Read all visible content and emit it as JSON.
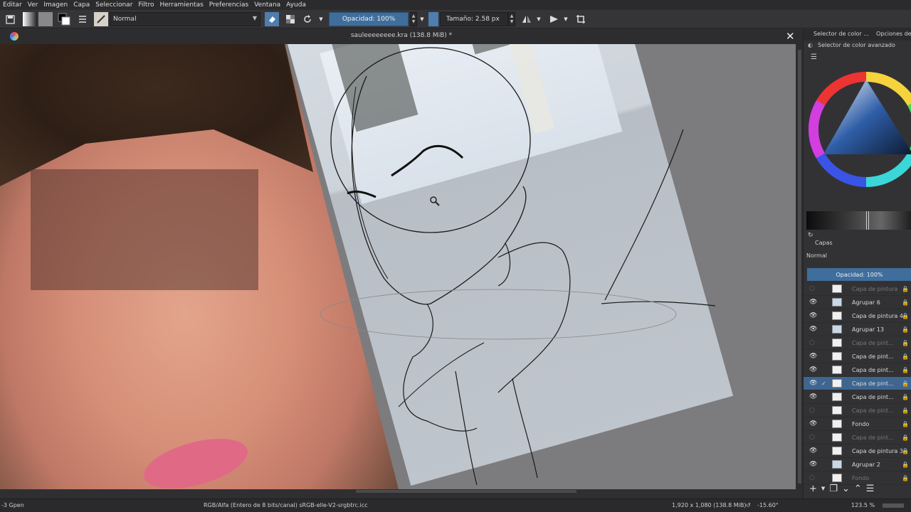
{
  "menu": [
    "Editar",
    "Ver",
    "Imagen",
    "Capa",
    "Seleccionar",
    "Filtro",
    "Herramientas",
    "Preferencias",
    "Ventana",
    "Ayuda"
  ],
  "toolbar": {
    "blend_mode": "Normal",
    "opacity": "Opacidad: 100%",
    "size": "Tamaño: 2.58 px"
  },
  "document": {
    "title": "sauleeeeeeee.kra (138.8 MiB) *"
  },
  "dock": {
    "tab_color": "Selector de color ...",
    "tab_options": "Opciones de",
    "advanced_label": "Selector de color avanzado"
  },
  "layers": {
    "header": "Capas",
    "blend_mode": "Normal",
    "opacity": "Opacidad:  100%",
    "items": [
      {
        "name": "Capa de pintura",
        "dim": true,
        "visible": false,
        "kind": "paint",
        "selected": false
      },
      {
        "name": "Agrupar 6",
        "dim": false,
        "visible": true,
        "kind": "folder",
        "selected": false
      },
      {
        "name": "Capa de pintura 4",
        "dim": false,
        "visible": true,
        "kind": "paint",
        "selected": false
      },
      {
        "name": "Agrupar 13",
        "dim": false,
        "visible": true,
        "kind": "folder",
        "selected": false
      },
      {
        "name": "Capa de pint...",
        "dim": true,
        "visible": false,
        "kind": "paint",
        "selected": false
      },
      {
        "name": "Capa de pint...",
        "dim": false,
        "visible": true,
        "kind": "paint",
        "selected": false
      },
      {
        "name": "Capa de pint...",
        "dim": false,
        "visible": true,
        "kind": "paint",
        "selected": false
      },
      {
        "name": "Capa de pint...",
        "dim": false,
        "visible": true,
        "kind": "paint",
        "selected": true
      },
      {
        "name": "Capa de pint...",
        "dim": false,
        "visible": true,
        "kind": "paint",
        "selected": false
      },
      {
        "name": "Capa de pint...",
        "dim": true,
        "visible": false,
        "kind": "paint",
        "selected": false
      },
      {
        "name": "Fondo",
        "dim": false,
        "visible": true,
        "kind": "paint",
        "selected": false
      },
      {
        "name": "Capa de pint...",
        "dim": true,
        "visible": false,
        "kind": "paint",
        "selected": false
      },
      {
        "name": "Capa de pintura 3",
        "dim": false,
        "visible": true,
        "kind": "paint",
        "selected": false
      },
      {
        "name": "Agrupar 2",
        "dim": false,
        "visible": true,
        "kind": "folder",
        "selected": false
      },
      {
        "name": "Fondo",
        "dim": true,
        "visible": false,
        "kind": "paint",
        "selected": false
      }
    ]
  },
  "status": {
    "brush": "-3 Gpen",
    "color_space": "RGB/Alfa (Entero de 8 bits/canal)  sRGB-elle-V2-srgbtrc.icc",
    "dimensions": "1,920 x 1,080 (138.8 MiB)",
    "rotation": "-15.60°",
    "zoom": "123.5 %"
  },
  "icons": [
    "save-icon",
    "pattern-icon",
    "gradient-icon",
    "color-swap-icon",
    "brush-presets-icon",
    "eraser-icon",
    "alpha-lock-icon",
    "reload-icon",
    "mirror-icon",
    "wrap-icon",
    "crop-icon",
    "close-icon",
    "magnifier-icon"
  ]
}
